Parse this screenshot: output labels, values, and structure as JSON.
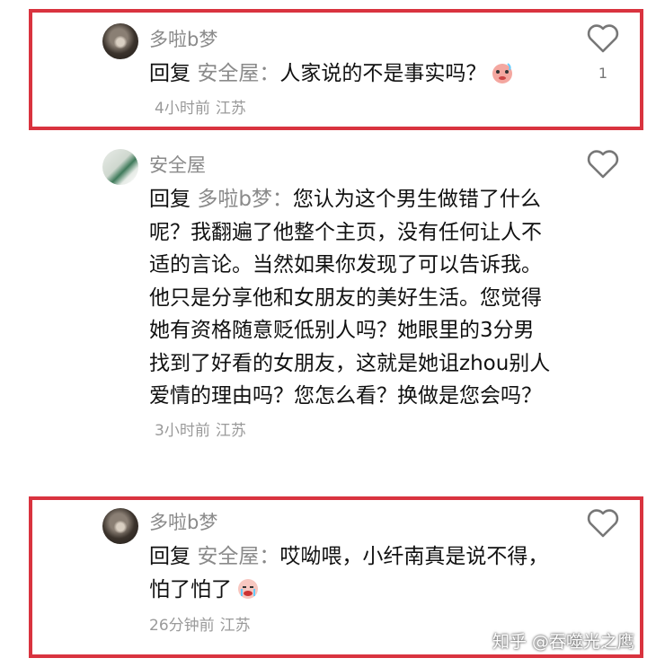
{
  "comments": [
    {
      "username": "多啦b梦",
      "reply_word": "回复",
      "reply_target": "安全屋：",
      "text": "人家说的不是事实吗？",
      "time": "4小时前",
      "location": "江苏",
      "likes": "1",
      "emoji": "embarrassed-face-emoji"
    },
    {
      "username": "安全屋",
      "reply_word": "回复",
      "reply_target": "多啦b梦：",
      "text": "您认为这个男生做错了什么呢？我翻遍了他整个主页，没有任何让人不适的言论。当然如果你发现了可以告诉我。他只是分享他和女朋友的美好生活。您觉得她有资格随意贬低别人吗？她眼里的3分男找到了好看的女朋友，这就是她诅zhou别人爱情的理由吗？您怎么看？换做是您会吗？",
      "time": "3小时前",
      "location": "江苏"
    },
    {
      "username": "多啦b梦",
      "reply_word": "回复",
      "reply_target": "安全屋：",
      "text": "哎呦喂，小纤南真是说不得，怕了怕了",
      "time": "26分钟前",
      "location": "江苏",
      "emoji": "crying-face-emoji"
    }
  ],
  "watermark": "知乎 @吞噬光之鹰",
  "colors": {
    "highlight": "#d9333f",
    "meta": "#9a9a9a"
  }
}
